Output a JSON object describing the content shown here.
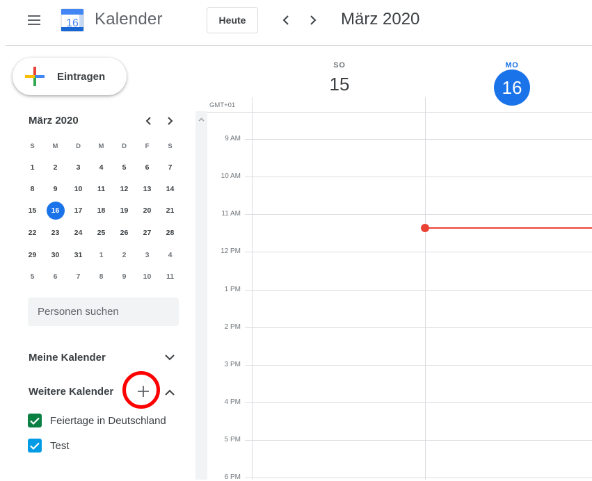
{
  "header": {
    "logo_day": "16",
    "app_title": "Kalender",
    "today_label": "Heute",
    "prev_label": "‹",
    "next_label": "›",
    "current_period": "März 2020"
  },
  "create": {
    "label": "Eintragen"
  },
  "mini_calendar": {
    "title": "März 2020",
    "weekdays": [
      "S",
      "M",
      "D",
      "M",
      "D",
      "F",
      "S"
    ],
    "weeks": [
      [
        "1",
        "2",
        "3",
        "4",
        "5",
        "6",
        "7"
      ],
      [
        "8",
        "9",
        "10",
        "11",
        "12",
        "13",
        "14"
      ],
      [
        "15",
        "16",
        "17",
        "18",
        "19",
        "20",
        "21"
      ],
      [
        "22",
        "23",
        "24",
        "25",
        "26",
        "27",
        "28"
      ],
      [
        "29",
        "30",
        "31",
        "1",
        "2",
        "3",
        "4"
      ],
      [
        "5",
        "6",
        "7",
        "8",
        "9",
        "10",
        "11"
      ]
    ],
    "today": "16"
  },
  "people_search": {
    "placeholder": "Personen suchen"
  },
  "my_calendars": {
    "label": "Meine Kalender"
  },
  "other_calendars": {
    "label": "Weitere Kalender",
    "items": [
      {
        "name": "Feiertage in Deutschland",
        "color": "#0b8043",
        "checked": true
      },
      {
        "name": "Test",
        "color": "#039be5",
        "checked": true
      }
    ]
  },
  "timezone": "GMT+01",
  "days": [
    {
      "dow": "SO",
      "num": "15",
      "is_today": false
    },
    {
      "dow": "MO",
      "num": "16",
      "is_today": true
    }
  ],
  "hours": [
    "9 AM",
    "10 AM",
    "11 AM",
    "12 PM",
    "1 PM",
    "2 PM",
    "3 PM",
    "4 PM",
    "5 PM",
    "6 PM"
  ],
  "colors": {
    "accent": "#1a73e8",
    "now_line": "#ea4335",
    "highlight": "#ff0000"
  }
}
